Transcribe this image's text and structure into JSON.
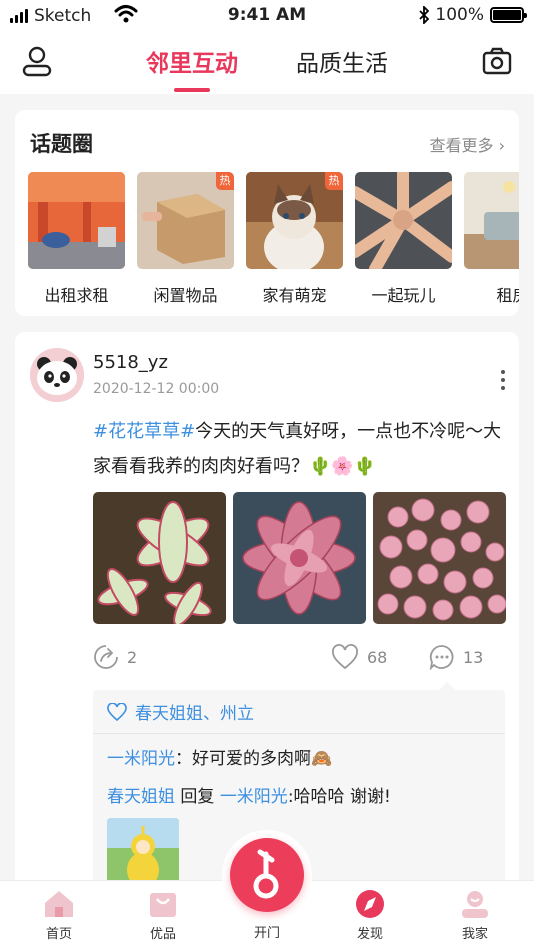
{
  "status_bar": {
    "carrier": "Sketch",
    "time": "9:41 AM",
    "battery": "100%",
    "battery_level": 1.0
  },
  "header": {
    "tabs": [
      {
        "label": "邻里互动",
        "active": true
      },
      {
        "label": "品质生活",
        "active": false
      }
    ],
    "user_icon": "user-icon",
    "camera_icon": "camera-icon"
  },
  "topics": {
    "title": "话题圈",
    "more_label": "查看更多",
    "items": [
      {
        "label": "出租求租",
        "hot": false,
        "hot_label": ""
      },
      {
        "label": "闲置物品",
        "hot": true,
        "hot_label": "热"
      },
      {
        "label": "家有萌宠",
        "hot": true,
        "hot_label": "热"
      },
      {
        "label": "一起玩儿",
        "hot": false,
        "hot_label": ""
      },
      {
        "label": "租房",
        "hot": false,
        "hot_label": ""
      }
    ]
  },
  "post": {
    "username": "5518_yz",
    "time": "2020-12-12 00:00",
    "hashtag": "#花花草草#",
    "text": "今天的天气真好呀，一点也不冷呢～大家看看我养的肉肉好看吗？🌵🌸🌵",
    "share_count": "2",
    "like_count": "68",
    "comment_count": "13",
    "liked_by": "春天姐姐、州立",
    "comments": [
      {
        "user": "一米阳光",
        "sep": "：",
        "text": "好可爱的多肉啊🙈"
      },
      {
        "user": "春天姐姐",
        "reply_word": " 回复 ",
        "reply_to": "一米阳光",
        "sep": ":",
        "text": "哈哈哈 谢谢!"
      }
    ]
  },
  "bottom_nav": {
    "items": [
      {
        "label": "首页"
      },
      {
        "label": "优品"
      },
      {
        "label": "开门"
      },
      {
        "label": "发现"
      },
      {
        "label": "我家"
      }
    ]
  },
  "colors": {
    "accent": "#e8385c",
    "link": "#3d8fe0"
  }
}
